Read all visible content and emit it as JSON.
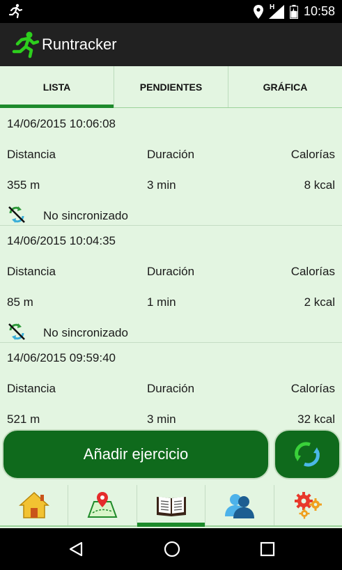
{
  "statusbar": {
    "time": "10:58",
    "network": "H"
  },
  "appbar": {
    "title": "Runtracker"
  },
  "tabs": [
    {
      "label": "LISTA",
      "active": true
    },
    {
      "label": "PENDIENTES",
      "active": false
    },
    {
      "label": "GRÁFICA",
      "active": false
    }
  ],
  "labels": {
    "distance": "Distancia",
    "duration": "Duración",
    "calories": "Calorías"
  },
  "entries": [
    {
      "date": "14/06/2015 10:06:08",
      "distance": "355 m",
      "duration": "3 min",
      "calories": "8 kcal",
      "sync_status": "No sincronizado"
    },
    {
      "date": "14/06/2015 10:04:35",
      "distance": "85 m",
      "duration": "1 min",
      "calories": "2 kcal",
      "sync_status": "No sincronizado"
    },
    {
      "date": "14/06/2015 09:59:40",
      "distance": "521 m",
      "duration": "3 min",
      "calories": "32 kcal"
    }
  ],
  "actions": {
    "add_label": "Añadir ejercicio"
  },
  "bottom_nav": [
    "home-icon",
    "map-icon",
    "book-icon",
    "users-icon",
    "settings-icon"
  ],
  "colors": {
    "background": "#e3f5e1",
    "primary": "#0f6a1c",
    "accent": "#1d8a2b",
    "appbar": "#212121"
  }
}
